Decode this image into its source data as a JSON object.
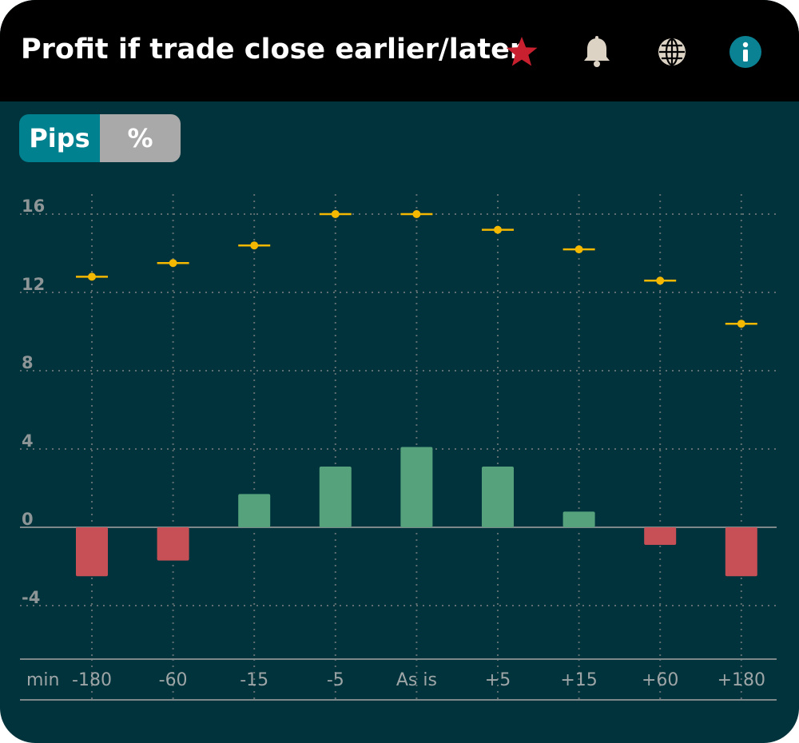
{
  "header": {
    "title": "Profit if trade close earlier/later",
    "icons": [
      "star-icon",
      "bell-icon",
      "globe-icon",
      "info-icon"
    ]
  },
  "toggle": {
    "pips_label": "Pips",
    "percent_label": "%"
  },
  "colors": {
    "background": "#00333b",
    "header": "#000000",
    "accent": "#00818f",
    "star": "#c8202e",
    "positive_bar": "#55a27c",
    "negative_bar": "#c65055",
    "marker": "#f5b800",
    "grid": "#5f6e70"
  },
  "chart_data": {
    "type": "bar",
    "x_prefix_label": "min",
    "categories": [
      "-180",
      "-60",
      "-15",
      "-5",
      "As is",
      "+5",
      "+15",
      "+60",
      "+180"
    ],
    "series": [
      {
        "type": "bar",
        "values": [
          -2.5,
          -1.7,
          1.7,
          3.1,
          4.1,
          3.1,
          0.8,
          -0.9,
          -2.5
        ]
      },
      {
        "type": "marker",
        "values": [
          12.8,
          13.5,
          14.4,
          16.0,
          16.0,
          15.2,
          14.2,
          12.6,
          10.4
        ]
      }
    ],
    "yticks": [
      16,
      12,
      8,
      4,
      0,
      -4
    ],
    "ylim": [
      -6.8,
      17.5
    ],
    "grid": true
  }
}
